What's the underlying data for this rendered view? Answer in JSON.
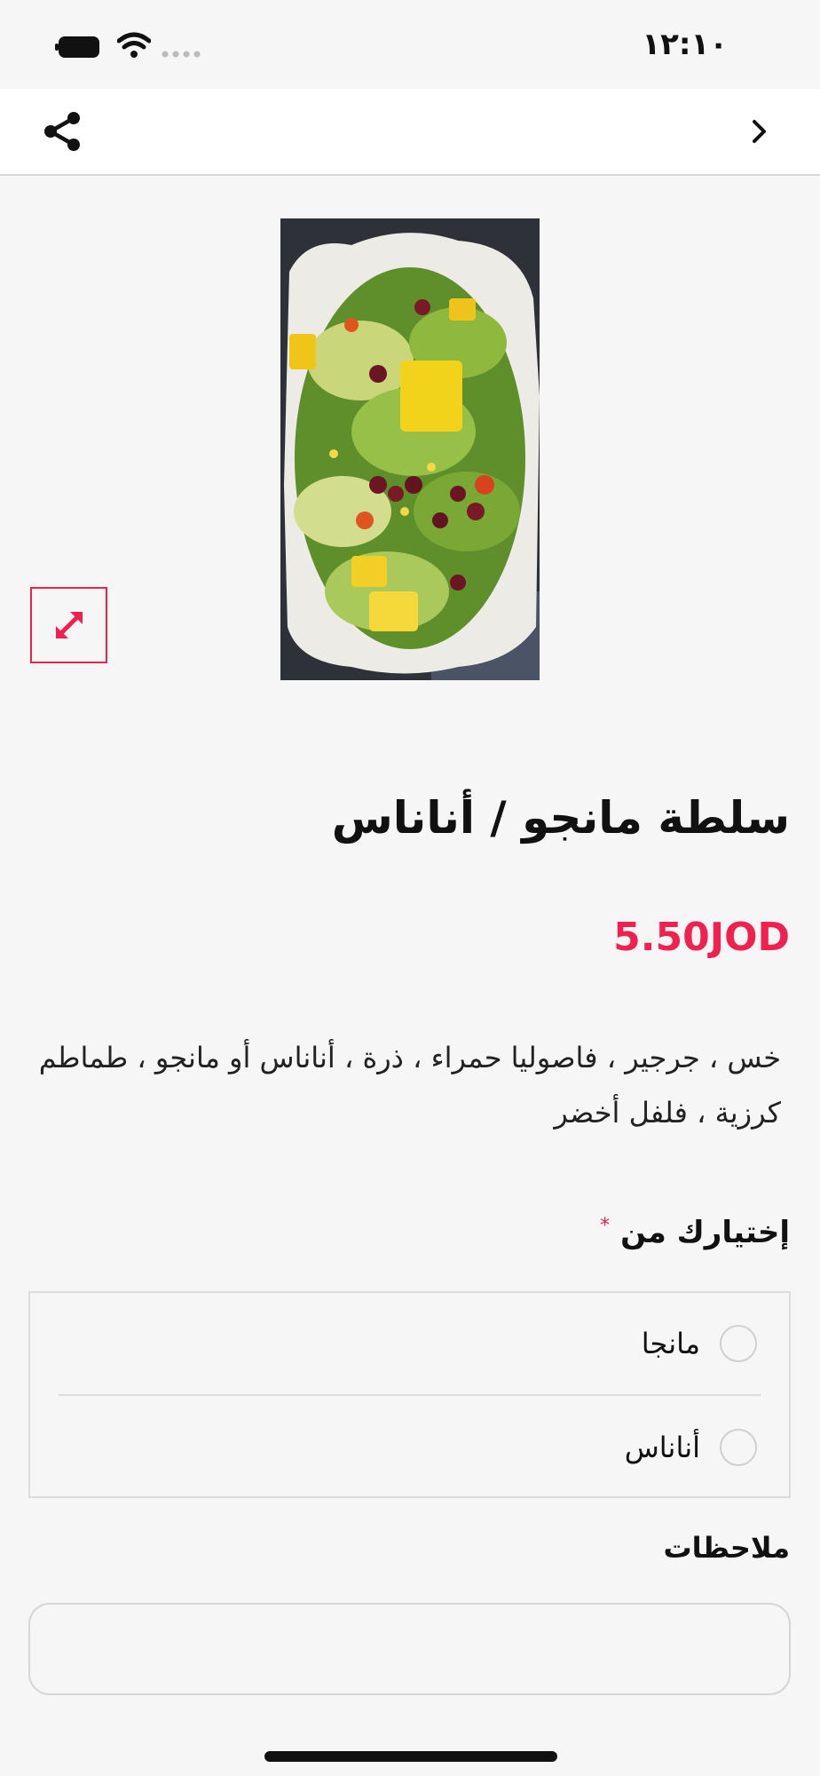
{
  "status_bar": {
    "time": "١٢:١٠",
    "battery_icon": "battery-icon",
    "wifi_icon": "wifi-icon",
    "signal_icon": "signal-icon"
  },
  "nav": {
    "share_icon": "share-icon",
    "back_icon": "chevron-right-icon"
  },
  "product": {
    "image_icon": "salad-photo",
    "expand_icon": "expand-icon",
    "title": "سلطة مانجو / أناناس",
    "price": "5.50JOD",
    "description": "خس ، جرجير ، فاصوليا حمراء ، ذرة ، أناناس أو مانجو ، طماطم كرزية ، فلفل أخضر"
  },
  "choice": {
    "label": "إختيارك من",
    "required_mark": "*",
    "options": [
      {
        "label": "مانجا",
        "selected": false
      },
      {
        "label": "أناناس",
        "selected": false
      }
    ]
  },
  "notes": {
    "label": "ملاحظات",
    "value": "",
    "placeholder": ""
  },
  "colors": {
    "accent": "#f0204f",
    "background": "#f6f6f6",
    "text": "#111111"
  }
}
